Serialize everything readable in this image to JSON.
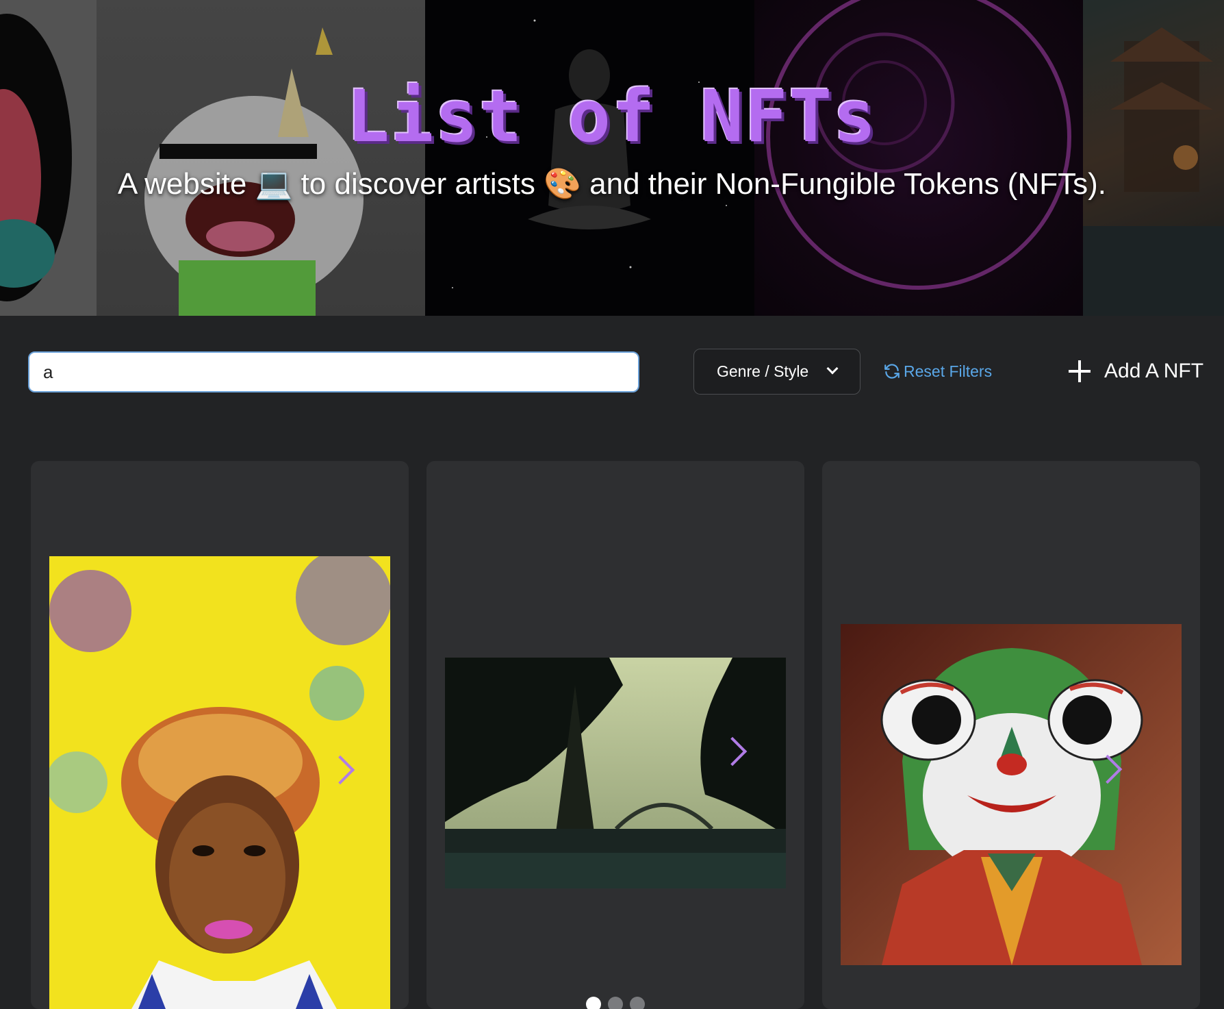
{
  "hero": {
    "title": "List of NFTs",
    "subtitle": "A website 💻 to discover artists 🎨 and their Non-Fungible Tokens (NFTs)."
  },
  "toolbar": {
    "search_value": "a",
    "genre_label": "Genre / Style",
    "reset_label": "Reset Filters",
    "add_label": "Add A NFT"
  },
  "cards": [
    {
      "image": "portrait-painting"
    },
    {
      "image": "eiffel-tower-photo",
      "carousel_pages": 3,
      "active_page": 1
    },
    {
      "image": "clown-character"
    }
  ],
  "colors": {
    "accent": "#b46cf0",
    "link": "#5aa7e8",
    "background": "#222325",
    "card": "#2e2f31"
  }
}
